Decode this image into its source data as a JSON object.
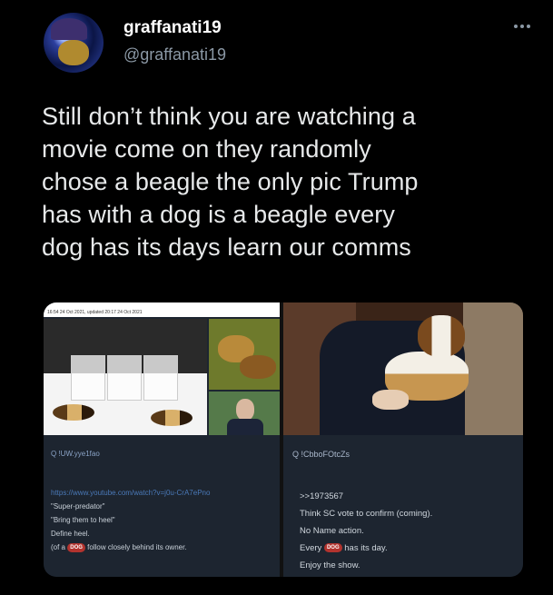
{
  "author": {
    "display_name": "graffanati19",
    "handle": "@graffanati19",
    "avatar_icon": "avatar-image",
    "more_icon": "more-options-icon"
  },
  "tweet": {
    "lines": [
      "Still don’t think you are watching a",
      "movie come on they randomly",
      "chose a beagle the only pic Trump",
      "has with a dog is a beagle every",
      "dog has its days learn our comms"
    ]
  },
  "media": {
    "left": {
      "news_meta": "16:54 24 Oct 2021, updated 20:17 24 Oct 2021",
      "q_label": "Q !UW.yye1fao",
      "post_lines": [
        "https://www.youtube.com/watch?v=j0u-CrA7ePno",
        "\"Super-predator\"",
        "\"Bring them to heel\"",
        "Define heel.",
        "(of a",
        "follow closely behind its owner."
      ],
      "badge": "DOG"
    },
    "right": {
      "q_label": "Q !CbboFOtcZs",
      "post_lines": [
        ">>1973567",
        "Think SC vote to confirm (coming).",
        "No Name action.",
        "Every",
        "has its day.",
        "Enjoy the show."
      ],
      "badge": "DOG"
    }
  }
}
